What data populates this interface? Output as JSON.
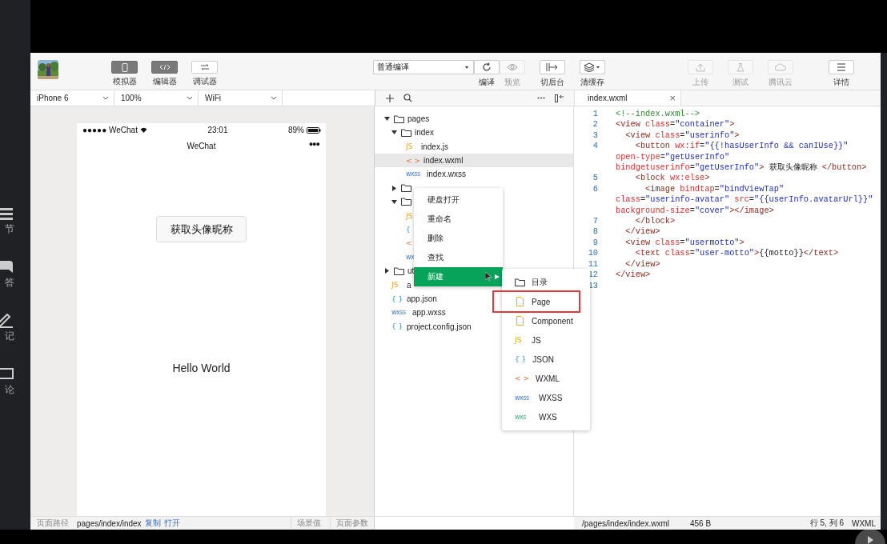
{
  "sidebar": {
    "items": [
      {
        "kind": "chapters",
        "label": "节"
      },
      {
        "kind": "qa",
        "label": "答"
      },
      {
        "kind": "notes",
        "label": "记"
      },
      {
        "kind": "comments",
        "label": "论"
      }
    ]
  },
  "toolbar": {
    "view_buttons": [
      {
        "kind": "phone",
        "label": "模拟器",
        "selected": true
      },
      {
        "kind": "code",
        "label": "编辑器",
        "selected": true
      },
      {
        "kind": "debug",
        "label": "调试器",
        "selected": false
      }
    ],
    "compile_mode": "普通编译",
    "actions": [
      {
        "kind": "refresh",
        "label": "编译",
        "disabled": false
      },
      {
        "kind": "eye",
        "label": "预览",
        "disabled": true
      },
      {
        "kind": "background",
        "label": "切后台",
        "disabled": false
      },
      {
        "kind": "layers",
        "label": "清缓存",
        "disabled": false
      }
    ],
    "right_actions": [
      {
        "kind": "upload",
        "label": "上传",
        "disabled": true
      },
      {
        "kind": "flask",
        "label": "测试",
        "disabled": true
      },
      {
        "kind": "cloud",
        "label": "腾讯云",
        "disabled": true
      },
      {
        "kind": "menu",
        "label": "详情",
        "disabled": false
      }
    ]
  },
  "simulator": {
    "selectors": [
      "iPhone 6",
      "100%",
      "WiFi"
    ],
    "status_bar": {
      "carrier": "●●●●● WeChat",
      "time": "23:01",
      "battery": "89%"
    },
    "nav_title": "WeChat",
    "nav_menu": "●●●",
    "button": "获取头像昵称",
    "motto": "Hello World"
  },
  "file_tree": {
    "items": [
      {
        "kind": "folder",
        "label": "pages",
        "expanded": true,
        "children": [
          {
            "kind": "folder",
            "label": "index",
            "expanded": true,
            "children": [
              {
                "kind": "js",
                "badge": "JS",
                "label": "index.js",
                "selected": false
              },
              {
                "kind": "wxml",
                "badge": "< >",
                "label": "index.wxml",
                "selected": true
              },
              {
                "kind": "wxss",
                "badge": "wxss",
                "label": "index.wxss",
                "selected": false
              }
            ]
          },
          {
            "kind": "folder",
            "expanded": false
          },
          {
            "kind": "folder",
            "expanded": true,
            "children": [
              {
                "kind": "js",
                "badge": "JS",
                "selected": false
              },
              {
                "kind": "json",
                "badge": "{",
                "selected": false
              },
              {
                "kind": "wxml",
                "badge": "<",
                "selected": false
              },
              {
                "kind": "wxss",
                "badge": "wx",
                "selected": false
              }
            ]
          }
        ]
      },
      {
        "kind": "folder",
        "label": "ut",
        "expanded": false
      },
      {
        "kind": "js",
        "badge": "JS",
        "label": "a",
        "selected": false
      },
      {
        "kind": "json",
        "badge": "{ }",
        "label": "app.json",
        "selected": false
      },
      {
        "kind": "wxss",
        "badge": "wxss",
        "label": "app.wxss",
        "selected": false
      },
      {
        "kind": "json",
        "badge": "{ }",
        "label": "project.config.json",
        "selected": false
      }
    ]
  },
  "context_menu": {
    "items": [
      {
        "label": "硬盘打开",
        "selected": false
      },
      {
        "label": "重命名",
        "selected": false
      },
      {
        "label": "删除",
        "selected": false
      },
      {
        "label": "查找",
        "selected": false
      },
      {
        "label": "新建",
        "selected": true,
        "has_submenu": true
      }
    ]
  },
  "submenu": {
    "items": [
      {
        "kind": "folder",
        "label": "目录",
        "highlighted": false
      },
      {
        "kind": "page",
        "label": "Page",
        "highlighted": true
      },
      {
        "kind": "page",
        "label": "Component",
        "highlighted": false
      },
      {
        "kind": "js",
        "badge": "JS",
        "label": "JS",
        "highlighted": false
      },
      {
        "kind": "json",
        "badge": "{ }",
        "label": "JSON",
        "highlighted": false
      },
      {
        "kind": "wxml",
        "badge": "< >",
        "label": "WXML",
        "highlighted": false
      },
      {
        "kind": "wxss",
        "badge": "wxss",
        "label": "WXSS",
        "highlighted": false
      },
      {
        "kind": "wxs",
        "badge": "wxs",
        "label": "WXS",
        "highlighted": false
      }
    ]
  },
  "editor": {
    "tab": {
      "label": "index.wxml",
      "close": "×"
    },
    "lines": [
      {
        "num": "1",
        "rows": [
          {
            "segments": [
              {
                "kind": "comment",
                "text": "<!--index.wxml-->"
              }
            ]
          }
        ]
      },
      {
        "num": "2",
        "rows": [
          {
            "segments": [
              {
                "kind": "tag",
                "text": "<view"
              },
              {
                "kind": "attr",
                "text": " class"
              },
              {
                "kind": "plain",
                "text": "="
              },
              {
                "kind": "string",
                "text": "\"container\""
              },
              {
                "kind": "tag",
                "text": ">"
              }
            ]
          }
        ]
      },
      {
        "num": "3",
        "rows": [
          {
            "segments": [
              {
                "kind": "tag",
                "text": "  <view"
              },
              {
                "kind": "attr",
                "text": " class"
              },
              {
                "kind": "plain",
                "text": "="
              },
              {
                "kind": "string",
                "text": "\"userinfo\""
              },
              {
                "kind": "tag",
                "text": ">"
              }
            ]
          }
        ]
      },
      {
        "num": "4",
        "rows": [
          {
            "segments": [
              {
                "kind": "tag",
                "text": "    <button"
              },
              {
                "kind": "attr",
                "text": " wx:if"
              },
              {
                "kind": "plain",
                "text": "="
              },
              {
                "kind": "string",
                "text": "\"{{!hasUserInfo && canIUse}}\""
              }
            ]
          },
          {
            "segments": [
              {
                "kind": "attr",
                "text": "open-type"
              },
              {
                "kind": "plain",
                "text": "="
              },
              {
                "kind": "string",
                "text": "\"getUserInfo\""
              }
            ]
          },
          {
            "segments": [
              {
                "kind": "attr",
                "text": "bindgetuserinfo"
              },
              {
                "kind": "plain",
                "text": "="
              },
              {
                "kind": "string",
                "text": "\"getUserInfo\""
              },
              {
                "kind": "tag",
                "text": ">"
              },
              {
                "kind": "plain",
                "text": " 获取头像昵称 "
              },
              {
                "kind": "tag",
                "text": "</button>"
              }
            ]
          }
        ]
      },
      {
        "num": "5",
        "rows": [
          {
            "segments": [
              {
                "kind": "tag",
                "text": "    <block"
              },
              {
                "kind": "attr",
                "text": " wx:else"
              },
              {
                "kind": "tag",
                "text": ">"
              }
            ]
          }
        ]
      },
      {
        "num": "6",
        "rows": [
          {
            "segments": [
              {
                "kind": "tag",
                "text": "      <image"
              },
              {
                "kind": "attr",
                "text": " bindtap"
              },
              {
                "kind": "plain",
                "text": "="
              },
              {
                "kind": "string",
                "text": "\"bindViewTap\""
              }
            ]
          },
          {
            "segments": [
              {
                "kind": "attr",
                "text": "class"
              },
              {
                "kind": "plain",
                "text": "="
              },
              {
                "kind": "string",
                "text": "\"userinfo-avatar\""
              },
              {
                "kind": "attr",
                "text": " src"
              },
              {
                "kind": "plain",
                "text": "="
              },
              {
                "kind": "string",
                "text": "\"{{userInfo.avatarUrl}}\""
              }
            ]
          },
          {
            "segments": [
              {
                "kind": "attr",
                "text": "background-size"
              },
              {
                "kind": "plain",
                "text": "="
              },
              {
                "kind": "string",
                "text": "\"cover\""
              },
              {
                "kind": "tag",
                "text": "></image>"
              }
            ]
          }
        ]
      },
      {
        "num": "7",
        "rows": [
          {
            "segments": [
              {
                "kind": "tag",
                "text": "    </block>"
              }
            ]
          }
        ]
      },
      {
        "num": "8",
        "rows": [
          {
            "segments": [
              {
                "kind": "tag",
                "text": "  </view>"
              }
            ]
          }
        ]
      },
      {
        "num": "9",
        "rows": [
          {
            "segments": [
              {
                "kind": "tag",
                "text": "  <view"
              },
              {
                "kind": "attr",
                "text": " class"
              },
              {
                "kind": "plain",
                "text": "="
              },
              {
                "kind": "string",
                "text": "\"usermotto\""
              },
              {
                "kind": "tag",
                "text": ">"
              }
            ]
          }
        ]
      },
      {
        "num": "10",
        "rows": [
          {
            "segments": [
              {
                "kind": "tag",
                "text": "    <text"
              },
              {
                "kind": "attr",
                "text": " class"
              },
              {
                "kind": "plain",
                "text": "="
              },
              {
                "kind": "string",
                "text": "\"user-motto\""
              },
              {
                "kind": "tag",
                "text": ">"
              },
              {
                "kind": "plain",
                "text": "{{motto}}"
              },
              {
                "kind": "tag",
                "text": "</text>"
              }
            ]
          }
        ]
      },
      {
        "num": "11",
        "rows": [
          {
            "segments": [
              {
                "kind": "tag",
                "text": "  </view>"
              }
            ]
          }
        ]
      },
      {
        "num": "12",
        "rows": [
          {
            "segments": [
              {
                "kind": "tag",
                "text": "</view>"
              }
            ]
          }
        ]
      },
      {
        "num": "13"
      }
    ]
  },
  "status_bar": {
    "path_label": "页面路径",
    "path": "pages/index/index",
    "links": [
      "复制",
      "打开"
    ],
    "scene": "场景值",
    "params": "页面参数",
    "file": "/pages/index/index.wxml",
    "size": "456 B",
    "position": "行 5, 列 6",
    "language": "WXML"
  }
}
